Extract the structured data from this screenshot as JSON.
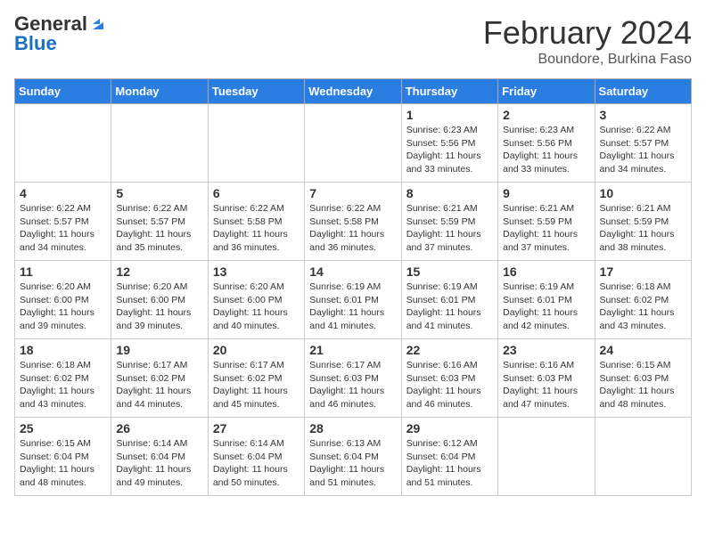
{
  "header": {
    "logo_general": "General",
    "logo_blue": "Blue",
    "month_year": "February 2024",
    "location": "Boundore, Burkina Faso"
  },
  "weekdays": [
    "Sunday",
    "Monday",
    "Tuesday",
    "Wednesday",
    "Thursday",
    "Friday",
    "Saturday"
  ],
  "weeks": [
    [
      {
        "day": "",
        "info": ""
      },
      {
        "day": "",
        "info": ""
      },
      {
        "day": "",
        "info": ""
      },
      {
        "day": "",
        "info": ""
      },
      {
        "day": "1",
        "info": "Sunrise: 6:23 AM\nSunset: 5:56 PM\nDaylight: 11 hours and 33 minutes."
      },
      {
        "day": "2",
        "info": "Sunrise: 6:23 AM\nSunset: 5:56 PM\nDaylight: 11 hours and 33 minutes."
      },
      {
        "day": "3",
        "info": "Sunrise: 6:22 AM\nSunset: 5:57 PM\nDaylight: 11 hours and 34 minutes."
      }
    ],
    [
      {
        "day": "4",
        "info": "Sunrise: 6:22 AM\nSunset: 5:57 PM\nDaylight: 11 hours and 34 minutes."
      },
      {
        "day": "5",
        "info": "Sunrise: 6:22 AM\nSunset: 5:57 PM\nDaylight: 11 hours and 35 minutes."
      },
      {
        "day": "6",
        "info": "Sunrise: 6:22 AM\nSunset: 5:58 PM\nDaylight: 11 hours and 36 minutes."
      },
      {
        "day": "7",
        "info": "Sunrise: 6:22 AM\nSunset: 5:58 PM\nDaylight: 11 hours and 36 minutes."
      },
      {
        "day": "8",
        "info": "Sunrise: 6:21 AM\nSunset: 5:59 PM\nDaylight: 11 hours and 37 minutes."
      },
      {
        "day": "9",
        "info": "Sunrise: 6:21 AM\nSunset: 5:59 PM\nDaylight: 11 hours and 37 minutes."
      },
      {
        "day": "10",
        "info": "Sunrise: 6:21 AM\nSunset: 5:59 PM\nDaylight: 11 hours and 38 minutes."
      }
    ],
    [
      {
        "day": "11",
        "info": "Sunrise: 6:20 AM\nSunset: 6:00 PM\nDaylight: 11 hours and 39 minutes."
      },
      {
        "day": "12",
        "info": "Sunrise: 6:20 AM\nSunset: 6:00 PM\nDaylight: 11 hours and 39 minutes."
      },
      {
        "day": "13",
        "info": "Sunrise: 6:20 AM\nSunset: 6:00 PM\nDaylight: 11 hours and 40 minutes."
      },
      {
        "day": "14",
        "info": "Sunrise: 6:19 AM\nSunset: 6:01 PM\nDaylight: 11 hours and 41 minutes."
      },
      {
        "day": "15",
        "info": "Sunrise: 6:19 AM\nSunset: 6:01 PM\nDaylight: 11 hours and 41 minutes."
      },
      {
        "day": "16",
        "info": "Sunrise: 6:19 AM\nSunset: 6:01 PM\nDaylight: 11 hours and 42 minutes."
      },
      {
        "day": "17",
        "info": "Sunrise: 6:18 AM\nSunset: 6:02 PM\nDaylight: 11 hours and 43 minutes."
      }
    ],
    [
      {
        "day": "18",
        "info": "Sunrise: 6:18 AM\nSunset: 6:02 PM\nDaylight: 11 hours and 43 minutes."
      },
      {
        "day": "19",
        "info": "Sunrise: 6:17 AM\nSunset: 6:02 PM\nDaylight: 11 hours and 44 minutes."
      },
      {
        "day": "20",
        "info": "Sunrise: 6:17 AM\nSunset: 6:02 PM\nDaylight: 11 hours and 45 minutes."
      },
      {
        "day": "21",
        "info": "Sunrise: 6:17 AM\nSunset: 6:03 PM\nDaylight: 11 hours and 46 minutes."
      },
      {
        "day": "22",
        "info": "Sunrise: 6:16 AM\nSunset: 6:03 PM\nDaylight: 11 hours and 46 minutes."
      },
      {
        "day": "23",
        "info": "Sunrise: 6:16 AM\nSunset: 6:03 PM\nDaylight: 11 hours and 47 minutes."
      },
      {
        "day": "24",
        "info": "Sunrise: 6:15 AM\nSunset: 6:03 PM\nDaylight: 11 hours and 48 minutes."
      }
    ],
    [
      {
        "day": "25",
        "info": "Sunrise: 6:15 AM\nSunset: 6:04 PM\nDaylight: 11 hours and 48 minutes."
      },
      {
        "day": "26",
        "info": "Sunrise: 6:14 AM\nSunset: 6:04 PM\nDaylight: 11 hours and 49 minutes."
      },
      {
        "day": "27",
        "info": "Sunrise: 6:14 AM\nSunset: 6:04 PM\nDaylight: 11 hours and 50 minutes."
      },
      {
        "day": "28",
        "info": "Sunrise: 6:13 AM\nSunset: 6:04 PM\nDaylight: 11 hours and 51 minutes."
      },
      {
        "day": "29",
        "info": "Sunrise: 6:12 AM\nSunset: 6:04 PM\nDaylight: 11 hours and 51 minutes."
      },
      {
        "day": "",
        "info": ""
      },
      {
        "day": "",
        "info": ""
      }
    ]
  ]
}
